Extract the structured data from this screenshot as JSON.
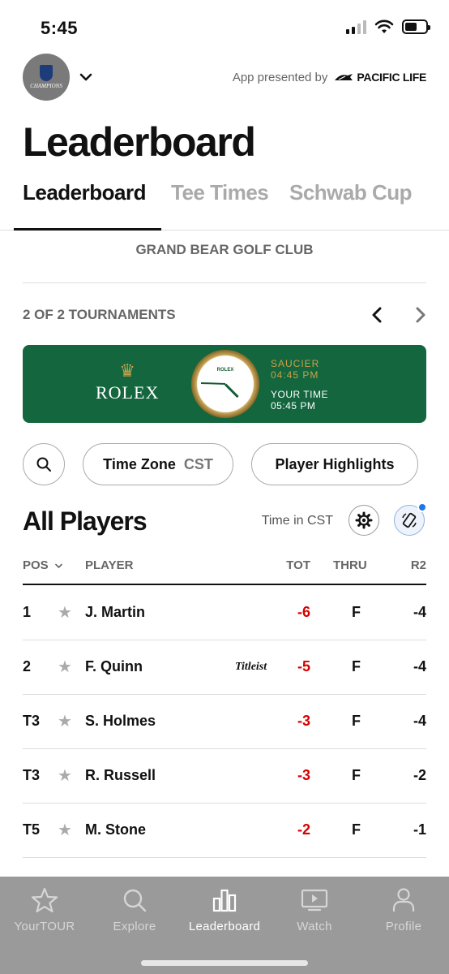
{
  "status_bar": {
    "time": "5:45"
  },
  "header": {
    "tour_logo_text": "CHAMPIONS",
    "presented_by": "App presented by",
    "sponsor": "PACIFIC LIFE"
  },
  "page_title": "Leaderboard",
  "tabs": [
    {
      "label": "Leaderboard",
      "active": true
    },
    {
      "label": "Tee Times",
      "active": false
    },
    {
      "label": "Schwab Cup",
      "active": false
    }
  ],
  "course": "GRAND BEAR GOLF CLUB",
  "tournaments": {
    "count_label": "2 OF 2 TOURNAMENTS"
  },
  "rolex": {
    "brand": "ROLEX",
    "clock_brand": "ROLEX",
    "location_label": "SAUCIER",
    "location_time": "04:45 PM",
    "your_time_label": "YOUR TIME",
    "your_time": "05:45 PM",
    "colors": {
      "banner": "#13663e",
      "gold": "#c8a24a"
    }
  },
  "filters": {
    "time_zone_label": "Time Zone",
    "time_zone_value": "CST",
    "highlights_label": "Player Highlights"
  },
  "section": {
    "title": "All Players",
    "time_in": "Time in CST"
  },
  "table": {
    "headers": {
      "pos": "POS",
      "player": "PLAYER",
      "tot": "TOT",
      "thru": "THRU",
      "r2": "R2"
    },
    "rows": [
      {
        "pos": "1",
        "name": "J. Martin",
        "sponsor": "",
        "tot": "-6",
        "thru": "F",
        "r2": "-4"
      },
      {
        "pos": "2",
        "name": "F. Quinn",
        "sponsor": "Titleist",
        "tot": "-5",
        "thru": "F",
        "r2": "-4"
      },
      {
        "pos": "T3",
        "name": "S. Holmes",
        "sponsor": "",
        "tot": "-3",
        "thru": "F",
        "r2": "-4"
      },
      {
        "pos": "T3",
        "name": "R. Russell",
        "sponsor": "",
        "tot": "-3",
        "thru": "F",
        "r2": "-2"
      },
      {
        "pos": "T5",
        "name": "M. Stone",
        "sponsor": "",
        "tot": "-2",
        "thru": "F",
        "r2": "-1"
      }
    ]
  },
  "tab_bar": [
    {
      "label": "YourTOUR",
      "icon": "star-icon",
      "active": false
    },
    {
      "label": "Explore",
      "icon": "search-icon",
      "active": false
    },
    {
      "label": "Leaderboard",
      "icon": "leaderboard-icon",
      "active": true
    },
    {
      "label": "Watch",
      "icon": "tv-icon",
      "active": false
    },
    {
      "label": "Profile",
      "icon": "person-icon",
      "active": false
    }
  ]
}
